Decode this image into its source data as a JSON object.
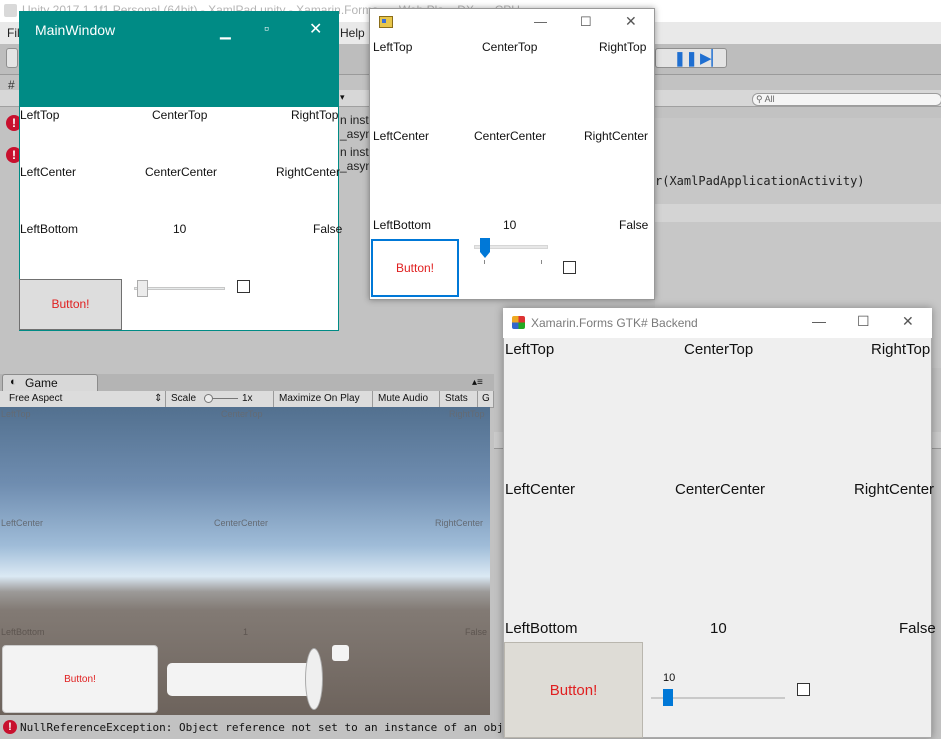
{
  "unity": {
    "title": "Unity 2017.1.1f1 Personal (64bit) - XamlPad.unity - Xamarin.Forms... - Web Pla... DX... - CPU",
    "menu": [
      "File",
      "Help"
    ],
    "console_lines": [
      {
        "line1": "n inst",
        "line2": "_asyn"
      },
      {
        "line1": "n inst",
        "line2": "_asyn"
      }
    ],
    "console_detail": "r(XamlPadApplicationActivity)",
    "search_placeholder": "All",
    "game_tab_label": "Game",
    "game_toolbar": {
      "aspect": "Free Aspect",
      "scale_label": "Scale",
      "scale_value": "1x",
      "maximize_on_play": "Maximize On Play",
      "mute_audio": "Mute Audio",
      "stats": "Stats",
      "gizmos": "G"
    },
    "game_labels": {
      "left_top": "LeftTop",
      "center_top": "CenterTop",
      "right_top": "RightTop",
      "left_center": "LeftCenter",
      "center_center": "CenterCenter",
      "right_center": "RightCenter",
      "left_bottom": "LeftBottom",
      "slider_value": "1",
      "toggle_value": "False"
    },
    "game_button_label": "Button!",
    "status_message": "NullReferenceException: Object reference not set to an instance of an object"
  },
  "wpf": {
    "title": "MainWindow",
    "labels": {
      "left_top": "LeftTop",
      "center_top": "CenterTop",
      "right_top": "RightTop",
      "left_center": "LeftCenter",
      "center_center": "CenterCenter",
      "right_center": "RightCenter",
      "left_bottom": "LeftBottom",
      "slider_value": "10",
      "checkbox_value": "False"
    },
    "button_label": "Button!",
    "slider": {
      "value": 10,
      "min": 0,
      "max": 100
    },
    "checkbox_checked": false
  },
  "winforms": {
    "labels": {
      "left_top": "LeftTop",
      "center_top": "CenterTop",
      "right_top": "RightTop",
      "left_center": "LeftCenter",
      "center_center": "CenterCenter",
      "right_center": "RightCenter",
      "left_bottom": "LeftBottom",
      "slider_value": "10",
      "checkbox_value": "False"
    },
    "button_label": "Button!",
    "slider": {
      "value": 10,
      "min": 0,
      "max": 100
    },
    "checkbox_checked": false
  },
  "gtk": {
    "title": "Xamarin.Forms GTK# Backend",
    "labels": {
      "left_top": "LeftTop",
      "center_top": "CenterTop",
      "right_top": "RightTop",
      "left_center": "LeftCenter",
      "center_center": "CenterCenter",
      "right_center": "RightCenter",
      "left_bottom": "LeftBottom",
      "slider_value": "10",
      "checkbox_value": "False"
    },
    "button_label": "Button!",
    "slider_caption": "10",
    "slider": {
      "value": 10,
      "min": 0,
      "max": 100
    },
    "checkbox_checked": false
  },
  "icons": {
    "minimize": "minimize-icon",
    "maximize": "maximize-icon",
    "close": "close-icon",
    "error": "error-icon",
    "app": "app-icon",
    "gtk": "gtk-cube-icon"
  },
  "colors": {
    "wpf_accent": "#008b85",
    "win_accent": "#0078d7",
    "button_text": "#e02020",
    "error": "#c8102e"
  }
}
